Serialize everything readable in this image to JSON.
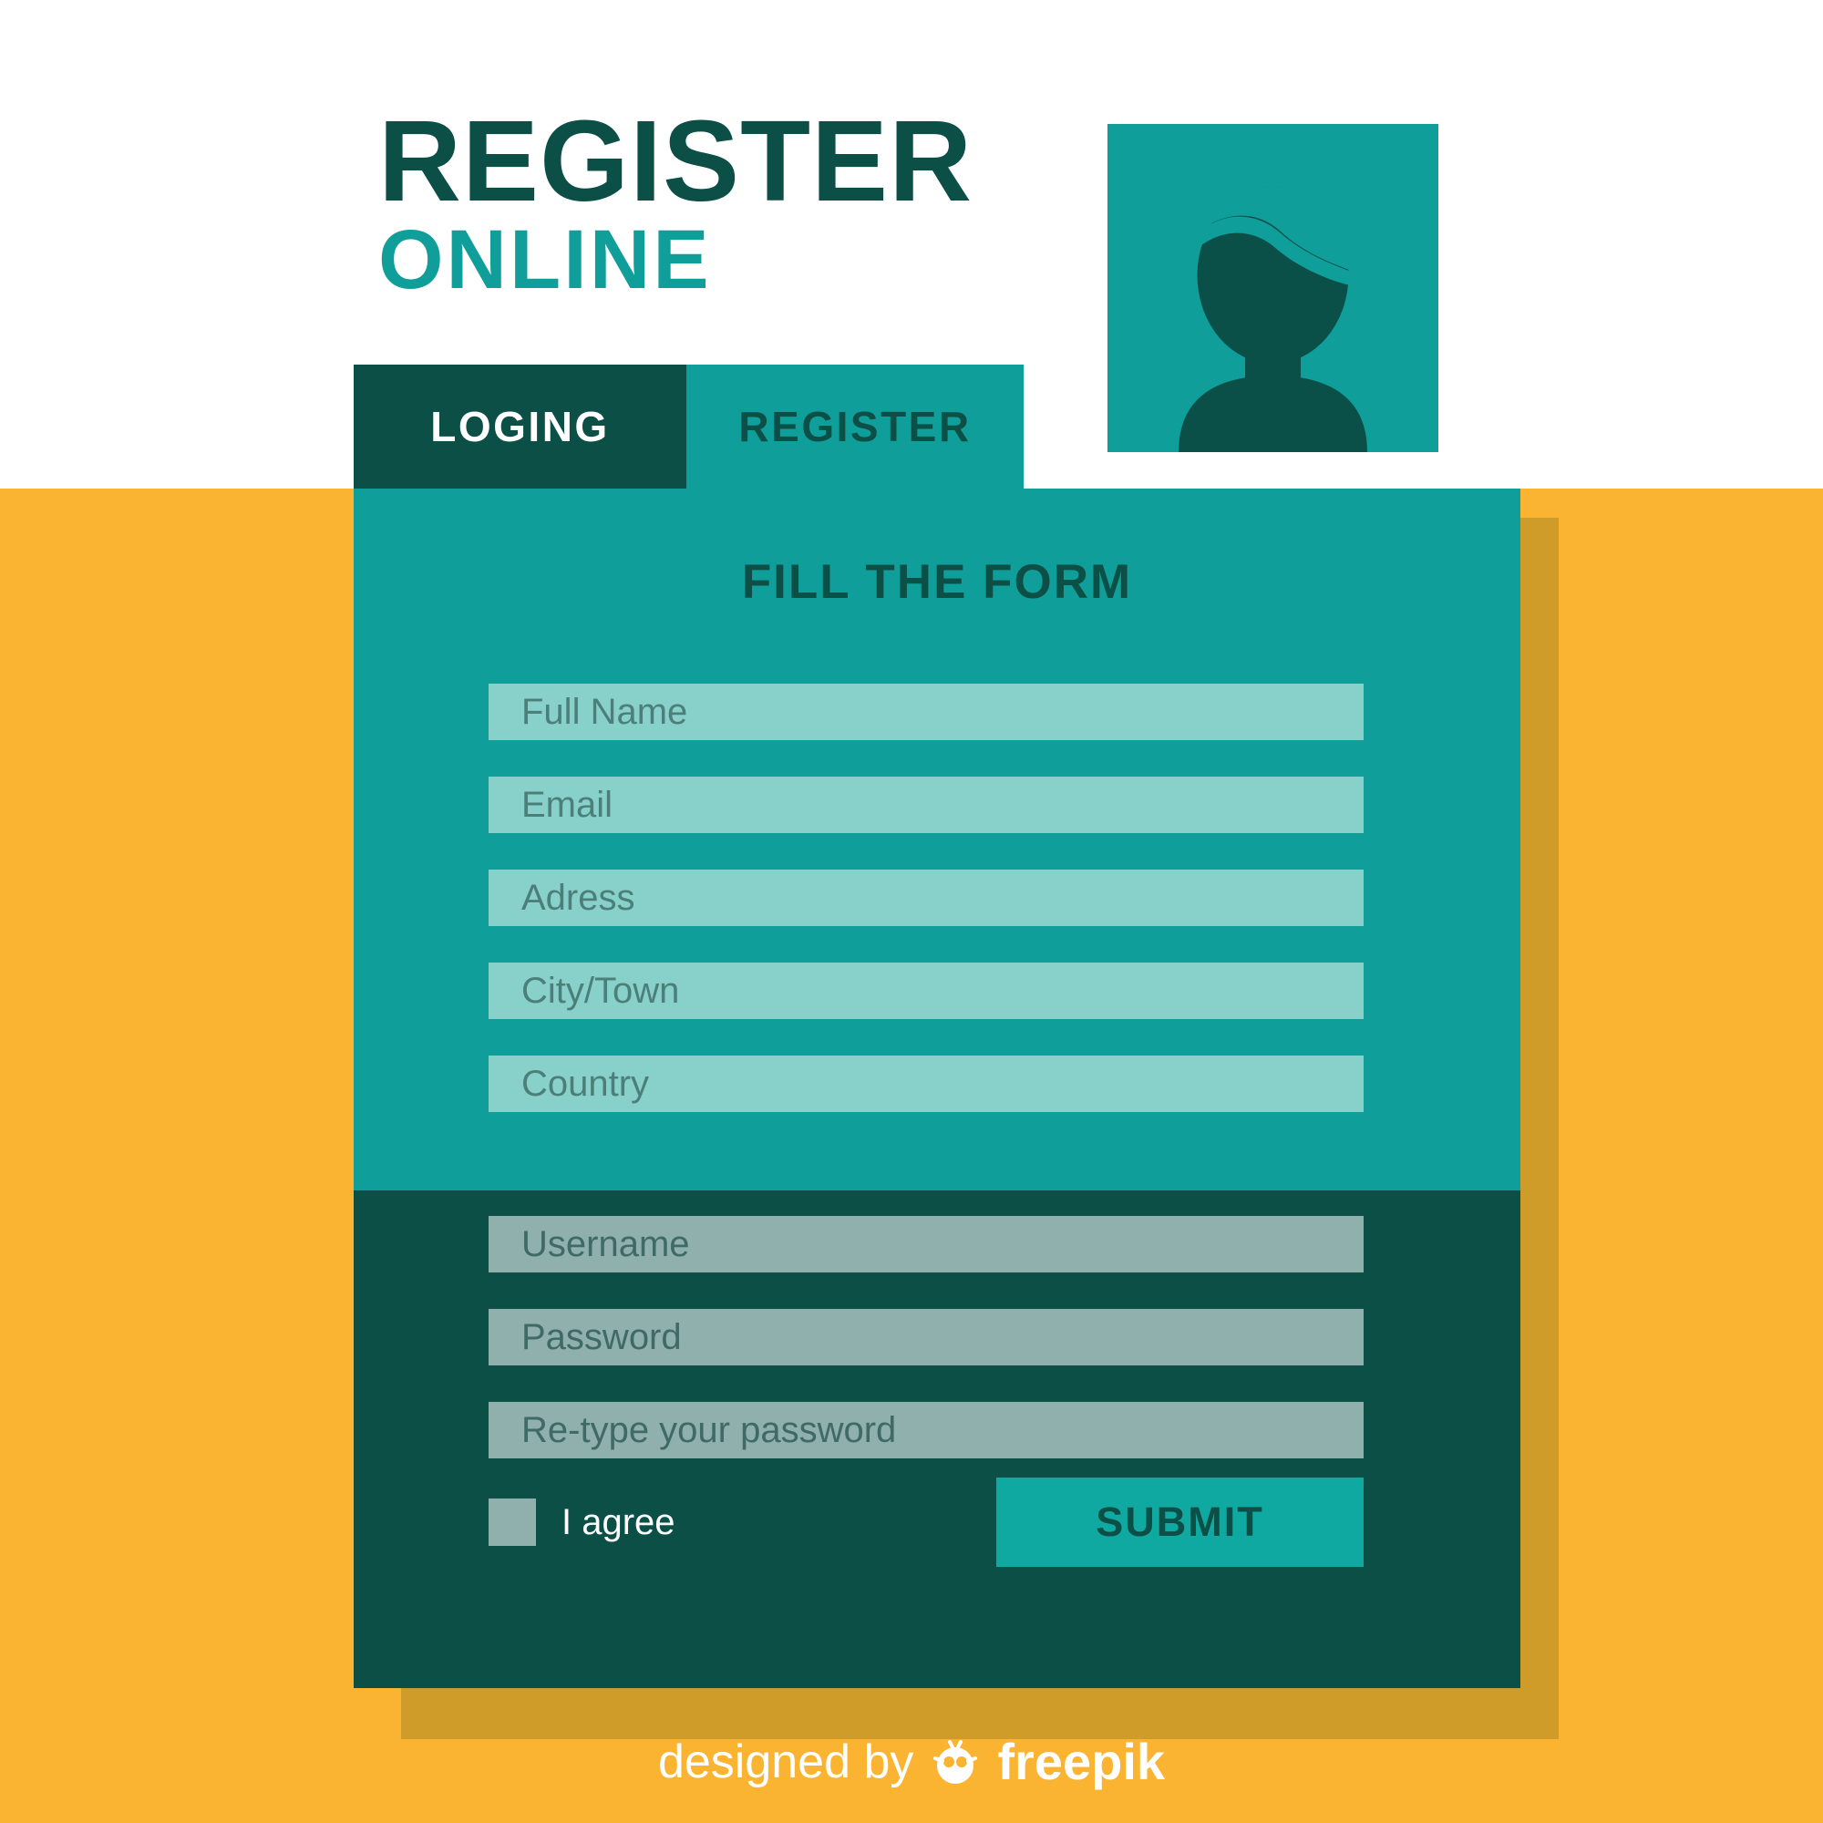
{
  "header": {
    "title_line1": "REGISTER",
    "title_line2": "ONLINE",
    "avatar_icon": "user-avatar-icon"
  },
  "tabs": [
    {
      "label": "LOGING",
      "active": false
    },
    {
      "label": "REGISTER",
      "active": true
    }
  ],
  "form": {
    "heading": "FILL THE FORM",
    "upper_fields": [
      {
        "placeholder": "Full Name"
      },
      {
        "placeholder": "Email"
      },
      {
        "placeholder": "Adress"
      },
      {
        "placeholder": "City/Town"
      },
      {
        "placeholder": "Country"
      }
    ],
    "lower_fields": [
      {
        "placeholder": "Username"
      },
      {
        "placeholder": "Password"
      },
      {
        "placeholder": "Re-type your password"
      }
    ],
    "agree_label": "I agree",
    "agree_checked": false,
    "submit_label": "SUBMIT"
  },
  "footer": {
    "designed_by": "designed by",
    "brand": "freepik",
    "mascot_icon": "freepik-mascot-icon"
  },
  "colors": {
    "background_orange": "#fab432",
    "card_shadow_orange": "#cf9c2a",
    "teal": "#0f9e99",
    "dark_teal": "#0b4f47",
    "field_light": "#88d1ca",
    "field_light_text": "#4d7f7a",
    "field_dark": "#8fb0ac",
    "field_dark_text": "#3f6a65",
    "submit_teal": "#0fa9a2",
    "white": "#ffffff"
  }
}
